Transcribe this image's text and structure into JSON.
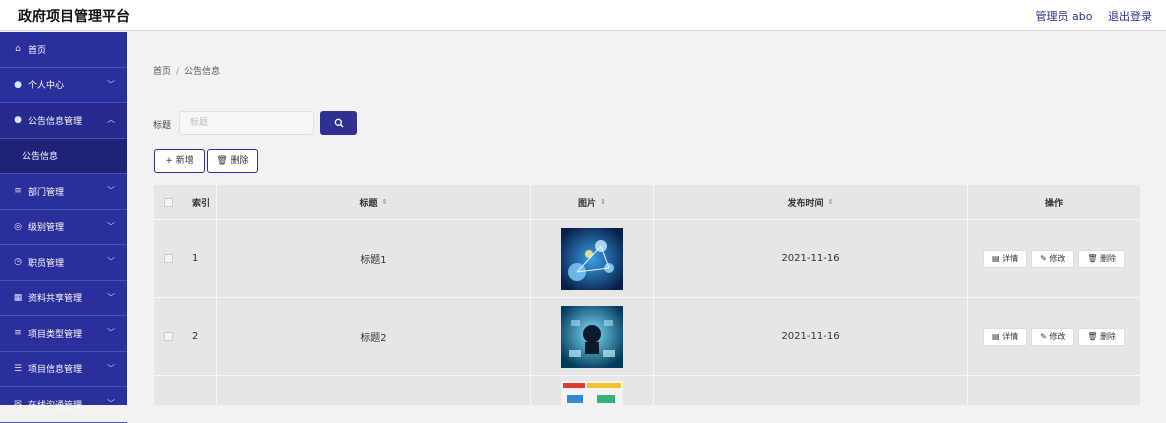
{
  "header": {
    "app_title": "政府项目管理平台",
    "user_label": "管理员 abo",
    "logout_label": "退出登录"
  },
  "sidebar": {
    "items": [
      {
        "label": "首页",
        "icon": "home-icon"
      },
      {
        "label": "个人中心",
        "icon": "user-icon"
      },
      {
        "label": "公告信息管理",
        "icon": "user-icon"
      },
      {
        "label": "公告信息",
        "icon": ""
      },
      {
        "label": "部门管理",
        "icon": "list-icon"
      },
      {
        "label": "级别管理",
        "icon": "circle-icon"
      },
      {
        "label": "职员管理",
        "icon": "clock-icon"
      },
      {
        "label": "资料共享管理",
        "icon": "grid-icon"
      },
      {
        "label": "项目类型管理",
        "icon": "list-icon"
      },
      {
        "label": "项目信息管理",
        "icon": "sliders-icon"
      },
      {
        "label": "在线沟通管理",
        "icon": "mail-icon"
      }
    ]
  },
  "breadcrumb": {
    "home": "首页",
    "sep": "/",
    "current": "公告信息"
  },
  "search": {
    "label": "标题",
    "placeholder": "标题"
  },
  "toolbar": {
    "add_label": "+ 新增",
    "delete_label": "删除"
  },
  "table": {
    "headers": {
      "index": "索引",
      "title": "标题",
      "image": "图片",
      "time": "发布时间",
      "ops": "操作"
    },
    "rows": [
      {
        "index": "1",
        "title": "标题1",
        "time": "2021-11-16"
      },
      {
        "index": "2",
        "title": "标题2",
        "time": "2021-11-16"
      }
    ],
    "ops": {
      "detail": "详情",
      "edit": "修改",
      "delete": "删除"
    }
  },
  "colors": {
    "primary": "#2e3192",
    "sidebar": "#2a2f9c"
  }
}
